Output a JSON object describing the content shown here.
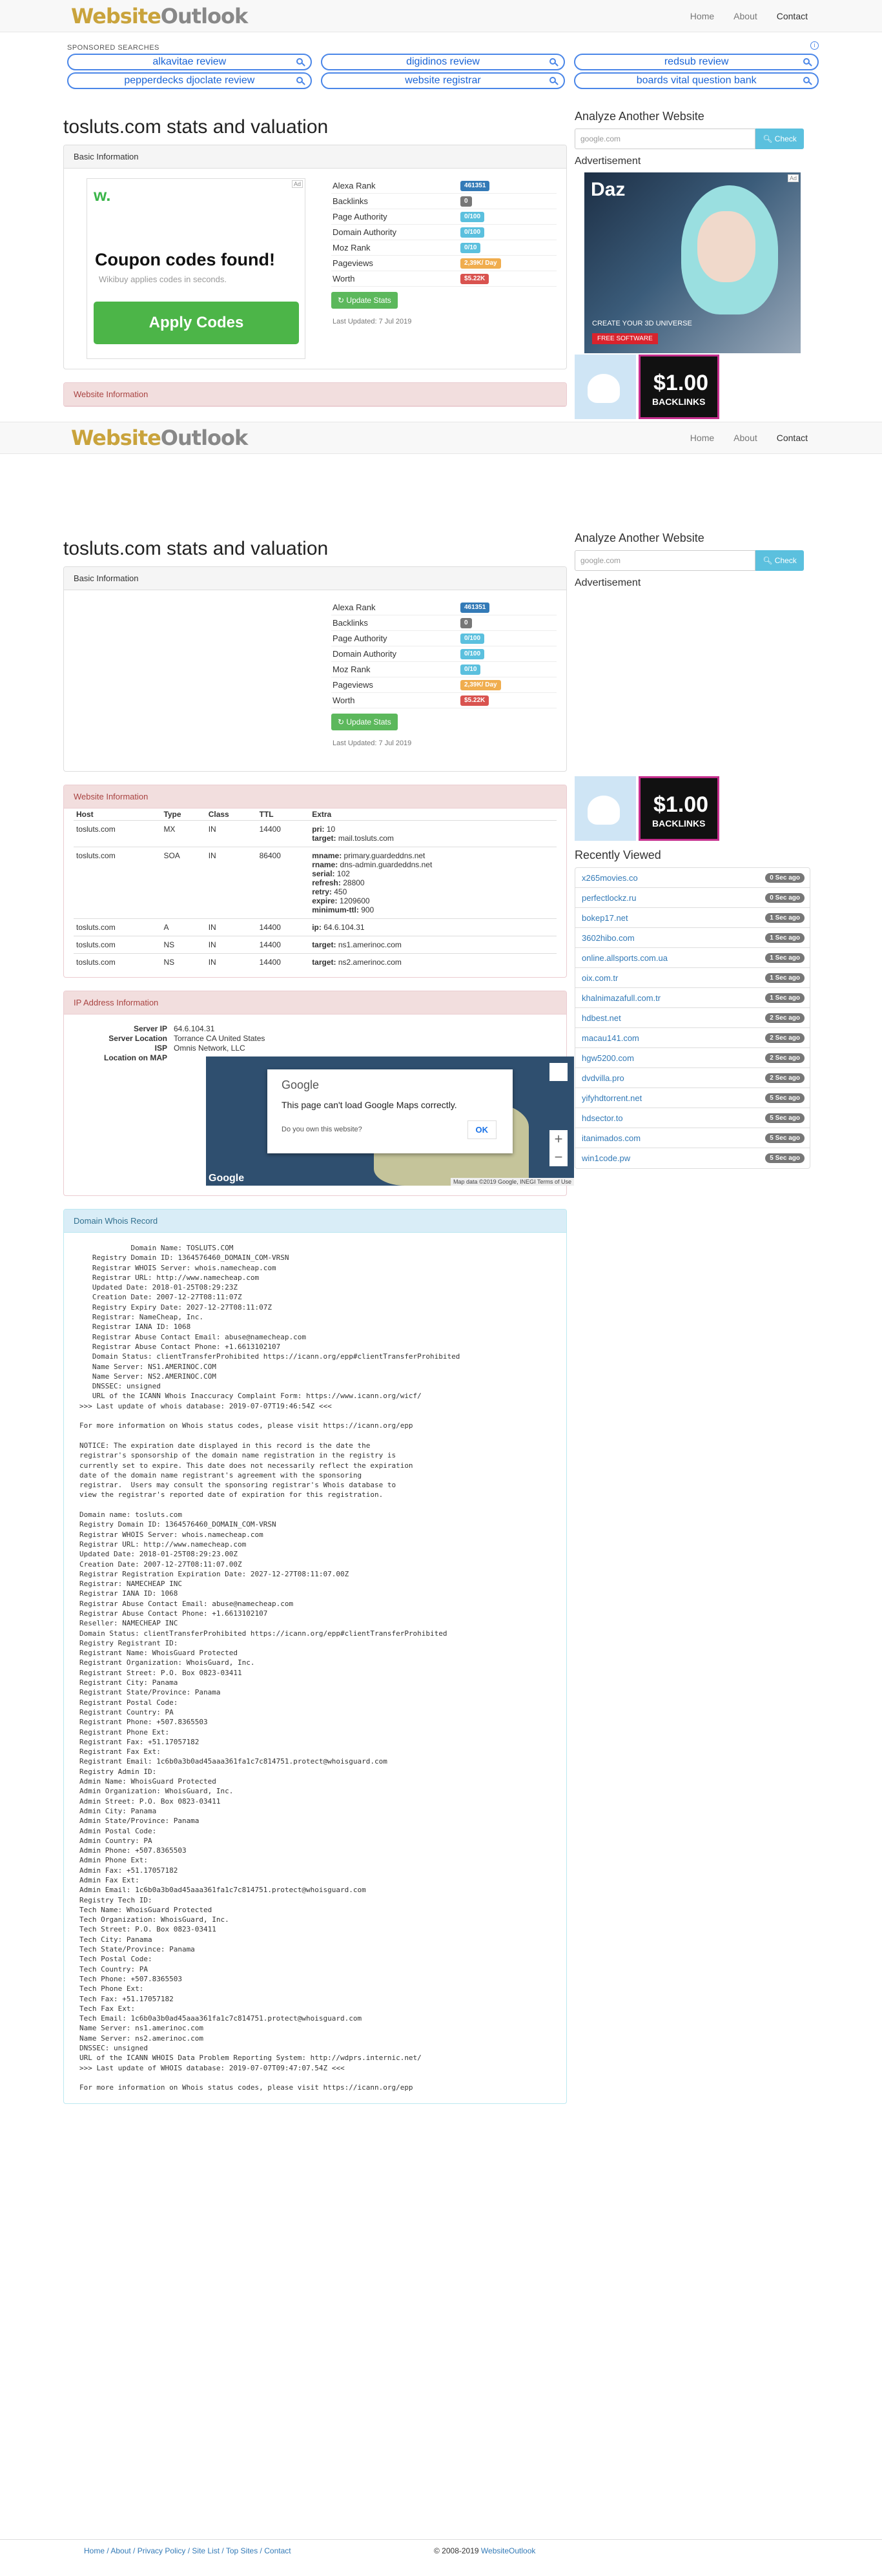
{
  "brand": {
    "left": "Website",
    "right": "Outlook"
  },
  "nav": [
    "Home",
    "About",
    "Contact"
  ],
  "sponsored": {
    "heading": "SPONSORED SEARCHES",
    "info": "i",
    "items": [
      "alkavitae review",
      "digidinos review",
      "redsub review",
      "pepperdecks djoclate review",
      "website registrar",
      "boards vital question bank"
    ]
  },
  "page_title": "tosluts.com stats and valuation",
  "basic": {
    "heading": "Basic Information",
    "ad": {
      "tag": "Ad",
      "logo": "w.",
      "headline": "Coupon codes found!",
      "sub": "Wikibuy applies codes in seconds.",
      "button": "Apply Codes"
    },
    "stats": [
      {
        "k": "Alexa Rank",
        "v": "461351",
        "c": "blue"
      },
      {
        "k": "Backlinks",
        "v": "0",
        "c": "gray"
      },
      {
        "k": "Page Authority",
        "v": "0/100",
        "c": "info"
      },
      {
        "k": "Domain Authority",
        "v": "0/100",
        "c": "info"
      },
      {
        "k": "Moz Rank",
        "v": "0/10",
        "c": "info"
      },
      {
        "k": "Pageviews",
        "v": "2,39K/ Day",
        "c": "warn"
      },
      {
        "k": "Worth",
        "v": "$5.22K",
        "c": "red"
      }
    ],
    "update": "Update Stats",
    "updated": "Last Updated: 7 Jul 2019"
  },
  "side": {
    "analyze": "Analyze Another Website",
    "placeholder": "google.com",
    "check": "Check",
    "advertisement": "Advertisement",
    "ad": {
      "tag": "Ad",
      "logo": "Daz",
      "create": "CREATE YOUR 3D UNIVERSE",
      "free": "FREE SOFTWARE"
    },
    "mini": {
      "price": "$1.00",
      "label": "BACKLINKS"
    }
  },
  "website_info": {
    "heading": "Website Information",
    "cols": [
      "Host",
      "Type",
      "Class",
      "TTL",
      "Extra"
    ],
    "rows": [
      {
        "host": "tosluts.com",
        "type": "MX",
        "class": "IN",
        "ttl": "14400",
        "extra": [
          [
            "pri:",
            "10"
          ],
          [
            "target:",
            "mail.tosluts.com"
          ]
        ]
      },
      {
        "host": "tosluts.com",
        "type": "SOA",
        "class": "IN",
        "ttl": "86400",
        "extra": [
          [
            "mname:",
            "primary.guardeddns.net"
          ],
          [
            "rname:",
            "dns-admin.guardeddns.net"
          ],
          [
            "serial:",
            "102"
          ],
          [
            "refresh:",
            "28800"
          ],
          [
            "retry:",
            "450"
          ],
          [
            "expire:",
            "1209600"
          ],
          [
            "minimum-ttl:",
            "900"
          ]
        ]
      },
      {
        "host": "tosluts.com",
        "type": "A",
        "class": "IN",
        "ttl": "14400",
        "extra": [
          [
            "ip:",
            "64.6.104.31"
          ]
        ]
      },
      {
        "host": "tosluts.com",
        "type": "NS",
        "class": "IN",
        "ttl": "14400",
        "extra": [
          [
            "target:",
            "ns1.amerinoc.com"
          ]
        ]
      },
      {
        "host": "tosluts.com",
        "type": "NS",
        "class": "IN",
        "ttl": "14400",
        "extra": [
          [
            "target:",
            "ns2.amerinoc.com"
          ]
        ]
      }
    ]
  },
  "ip": {
    "heading": "IP Address Information",
    "rows": [
      [
        "Server IP",
        "64.6.104.31"
      ],
      [
        "Server Location",
        "Torrance CA United States"
      ],
      [
        "ISP",
        "Omnis Network, LLC"
      ],
      [
        "Location on MAP",
        ""
      ]
    ],
    "map": {
      "google": "Google",
      "msg": "This page can't load Google Maps correctly.",
      "q": "Do you own this website?",
      "ok": "OK",
      "foot": "Map data ©2019 Google, INEGI  Terms of Use"
    }
  },
  "recently": {
    "title": "Recently Viewed",
    "items": [
      [
        "x265movies.co",
        "0 Sec ago"
      ],
      [
        "perfectlockz.ru",
        "0 Sec ago"
      ],
      [
        "bokep17.net",
        "1 Sec ago"
      ],
      [
        "3602hibo.com",
        "1 Sec ago"
      ],
      [
        "online.allsports.com.ua",
        "1 Sec ago"
      ],
      [
        "oix.com.tr",
        "1 Sec ago"
      ],
      [
        "khalnimazafull.com.tr",
        "1 Sec ago"
      ],
      [
        "hdbest.net",
        "2 Sec ago"
      ],
      [
        "macau141.com",
        "2 Sec ago"
      ],
      [
        "hgw5200.com",
        "2 Sec ago"
      ],
      [
        "dvdvilla.pro",
        "2 Sec ago"
      ],
      [
        "yifyhdtorrent.net",
        "5 Sec ago"
      ],
      [
        "hdsector.to",
        "5 Sec ago"
      ],
      [
        "itanimados.com",
        "5 Sec ago"
      ],
      [
        "win1code.pw",
        "5 Sec ago"
      ]
    ]
  },
  "whois": {
    "heading": "Domain Whois Record",
    "text": "            Domain Name: TOSLUTS.COM\n   Registry Domain ID: 1364576460_DOMAIN_COM-VRSN\n   Registrar WHOIS Server: whois.namecheap.com\n   Registrar URL: http://www.namecheap.com\n   Updated Date: 2018-01-25T08:29:23Z\n   Creation Date: 2007-12-27T08:11:07Z\n   Registry Expiry Date: 2027-12-27T08:11:07Z\n   Registrar: NameCheap, Inc.\n   Registrar IANA ID: 1068\n   Registrar Abuse Contact Email: abuse@namecheap.com\n   Registrar Abuse Contact Phone: +1.6613102107\n   Domain Status: clientTransferProhibited https://icann.org/epp#clientTransferProhibited\n   Name Server: NS1.AMERINOC.COM\n   Name Server: NS2.AMERINOC.COM\n   DNSSEC: unsigned\n   URL of the ICANN Whois Inaccuracy Complaint Form: https://www.icann.org/wicf/\n>>> Last update of whois database: 2019-07-07T19:46:54Z <<<\n\nFor more information on Whois status codes, please visit https://icann.org/epp\n\nNOTICE: The expiration date displayed in this record is the date the\nregistrar's sponsorship of the domain name registration in the registry is\ncurrently set to expire. This date does not necessarily reflect the expiration\ndate of the domain name registrant's agreement with the sponsoring\nregistrar.  Users may consult the sponsoring registrar's Whois database to\nview the registrar's reported date of expiration for this registration.\n\nDomain name: tosluts.com\nRegistry Domain ID: 1364576460_DOMAIN_COM-VRSN\nRegistrar WHOIS Server: whois.namecheap.com\nRegistrar URL: http://www.namecheap.com\nUpdated Date: 2018-01-25T08:29:23.00Z\nCreation Date: 2007-12-27T08:11:07.00Z\nRegistrar Registration Expiration Date: 2027-12-27T08:11:07.00Z\nRegistrar: NAMECHEAP INC\nRegistrar IANA ID: 1068\nRegistrar Abuse Contact Email: abuse@namecheap.com\nRegistrar Abuse Contact Phone: +1.6613102107\nReseller: NAMECHEAP INC\nDomain Status: clientTransferProhibited https://icann.org/epp#clientTransferProhibited\nRegistry Registrant ID:\nRegistrant Name: WhoisGuard Protected\nRegistrant Organization: WhoisGuard, Inc.\nRegistrant Street: P.O. Box 0823-03411\nRegistrant City: Panama\nRegistrant State/Province: Panama\nRegistrant Postal Code:\nRegistrant Country: PA\nRegistrant Phone: +507.8365503\nRegistrant Phone Ext:\nRegistrant Fax: +51.17057182\nRegistrant Fax Ext:\nRegistrant Email: 1c6b0a3b0ad45aaa361fa1c7c814751.protect@whoisguard.com\nRegistry Admin ID:\nAdmin Name: WhoisGuard Protected\nAdmin Organization: WhoisGuard, Inc.\nAdmin Street: P.O. Box 0823-03411\nAdmin City: Panama\nAdmin State/Province: Panama\nAdmin Postal Code:\nAdmin Country: PA\nAdmin Phone: +507.8365503\nAdmin Phone Ext:\nAdmin Fax: +51.17057182\nAdmin Fax Ext:\nAdmin Email: 1c6b0a3b0ad45aaa361fa1c7c814751.protect@whoisguard.com\nRegistry Tech ID:\nTech Name: WhoisGuard Protected\nTech Organization: WhoisGuard, Inc.\nTech Street: P.O. Box 0823-03411\nTech City: Panama\nTech State/Province: Panama\nTech Postal Code:\nTech Country: PA\nTech Phone: +507.8365503\nTech Phone Ext:\nTech Fax: +51.17057182\nTech Fax Ext:\nTech Email: 1c6b0a3b0ad45aaa361fa1c7c814751.protect@whoisguard.com\nName Server: ns1.amerinoc.com\nName Server: ns2.amerinoc.com\nDNSSEC: unsigned\nURL of the ICANN WHOIS Data Problem Reporting System: http://wdprs.internic.net/\n>>> Last update of WHOIS database: 2019-07-07T09:47:07.54Z <<<\n\nFor more information on Whois status codes, please visit https://icann.org/epp"
  },
  "footer": {
    "links": "Home / About / Privacy Policy / Site List / Top Sites / Contact",
    "copy": "© 2008-2019 ",
    "brand": "WebsiteOutlook"
  }
}
